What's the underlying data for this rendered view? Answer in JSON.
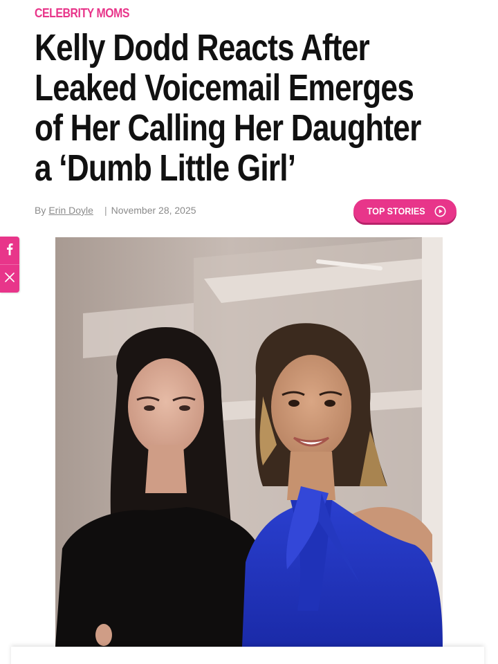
{
  "article": {
    "category": "CELEBRITY MOMS",
    "headline": "Kelly Dodd Reacts After Leaked Voicemail Emerges of Her Calling Her Daughter a ‘Dumb Little Girl’",
    "byline_prefix": "By",
    "author": "Erin Doyle",
    "separator": "|",
    "date": "November 28, 2025"
  },
  "buttons": {
    "top_stories": "TOP STORIES"
  },
  "share": {
    "items": [
      {
        "icon": "facebook-icon"
      },
      {
        "icon": "x-icon"
      }
    ]
  },
  "colors": {
    "accent": "#e8358a",
    "headline": "#111111",
    "meta": "#8a8a8a"
  }
}
